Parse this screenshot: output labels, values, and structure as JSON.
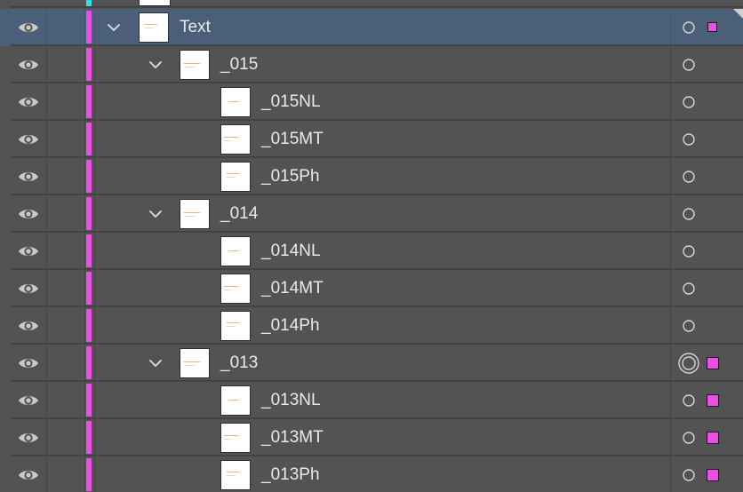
{
  "layers_panel": {
    "highlight_color": "#ea4ee4",
    "parent_layer_color": "#2ee0e8",
    "selection_row_color": "#4b6078",
    "rows": [
      {
        "label": "Text",
        "level": 0,
        "expanded": true,
        "selected": true,
        "target": "circle",
        "selection_marker": true
      },
      {
        "label": "_015",
        "level": 1,
        "expanded": true,
        "selected": false,
        "target": "circle",
        "selection_marker": false
      },
      {
        "label": "_015NL",
        "level": 2,
        "expanded": null,
        "selected": false,
        "target": "circle",
        "selection_marker": false
      },
      {
        "label": "_015MT",
        "level": 2,
        "expanded": null,
        "selected": false,
        "target": "circle",
        "selection_marker": false
      },
      {
        "label": "_015Ph",
        "level": 2,
        "expanded": null,
        "selected": false,
        "target": "circle",
        "selection_marker": false
      },
      {
        "label": "_014",
        "level": 1,
        "expanded": true,
        "selected": false,
        "target": "circle",
        "selection_marker": false
      },
      {
        "label": "_014NL",
        "level": 2,
        "expanded": null,
        "selected": false,
        "target": "circle",
        "selection_marker": false
      },
      {
        "label": "_014MT",
        "level": 2,
        "expanded": null,
        "selected": false,
        "target": "circle",
        "selection_marker": false
      },
      {
        "label": "_014Ph",
        "level": 2,
        "expanded": null,
        "selected": false,
        "target": "circle",
        "selection_marker": false
      },
      {
        "label": "_013",
        "level": 1,
        "expanded": true,
        "selected": false,
        "target": "double-circle",
        "selection_marker": true
      },
      {
        "label": "_013NL",
        "level": 2,
        "expanded": null,
        "selected": false,
        "target": "circle",
        "selection_marker": true
      },
      {
        "label": "_013MT",
        "level": 2,
        "expanded": null,
        "selected": false,
        "target": "circle",
        "selection_marker": true
      },
      {
        "label": "_013Ph",
        "level": 2,
        "expanded": null,
        "selected": false,
        "target": "circle",
        "selection_marker": true
      }
    ]
  }
}
